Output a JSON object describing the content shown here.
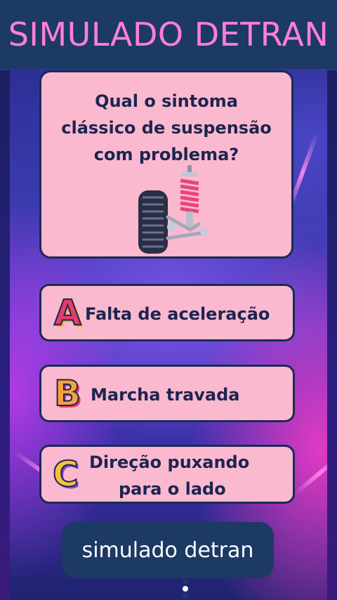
{
  "header": {
    "title": "SIMULADO DETRAN"
  },
  "question": {
    "lines": [
      "Qual o sintoma",
      "clássico de suspensão",
      "com problema?"
    ],
    "illustration": "car-suspension-icon"
  },
  "options": [
    {
      "letter": "A",
      "label": "Falta de aceleração"
    },
    {
      "letter": "B",
      "label": "Marcha travada"
    },
    {
      "letter": "C",
      "label_lines": [
        "Direção puxando",
        "para o lado"
      ]
    }
  ],
  "bubble": {
    "text": "simulado detran"
  },
  "colors": {
    "header_bg": "#1c3a63",
    "title": "#ff7fd6",
    "card_bg": "#fbb9d0",
    "card_border": "#1b2a55",
    "text_dark": "#1c2550"
  }
}
